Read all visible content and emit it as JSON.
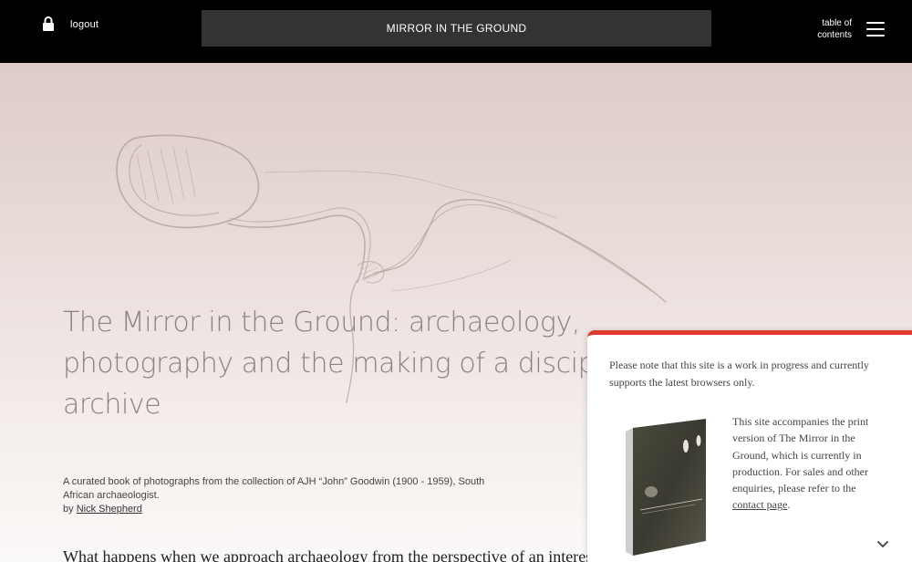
{
  "header": {
    "logout_label": "logout",
    "lock_icon": "lock-icon",
    "site_title": "MIRROR IN THE GROUND",
    "toc_line1": "table of",
    "toc_line2": "contents",
    "menu_icon": "hamburger-menu-icon"
  },
  "hero": {
    "title_line1": "The Mirror in the Ground: archaeology,",
    "title_line2": "photography and the making of a disciplinary",
    "title_line3": "archive",
    "description_line1": "A curated book of photographs from the collection of AJH “John” Goodwin (1900 - 1959), South",
    "description_line2": "African archaeologist.",
    "by_label": "by ",
    "author": "Nick Shepherd",
    "lead": "What happens when we approach archaeology from the perspective of an interest"
  },
  "notice": {
    "accent_color": "#e03a2e",
    "intro": "Please note that this site is a work in progress and currently supports the latest browsers only.",
    "side_text": "This site accompanies the print version of The Mirror in the Ground, which is currently in production. For sales and other enquiries, please refer to the ",
    "contact_link": "contact page",
    "side_text_end": ".",
    "book_title": "THE MIRROR IN THE GROUND",
    "chevron_icon": "chevron-down-icon"
  }
}
